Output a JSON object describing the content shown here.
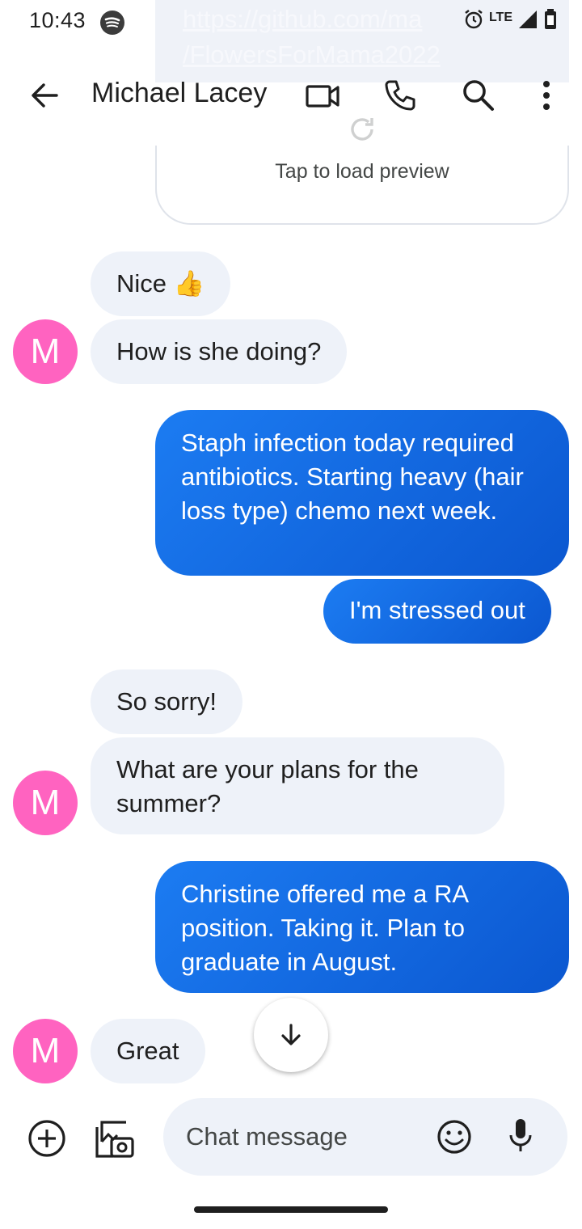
{
  "status_bar": {
    "time": "10:43",
    "network": "LTE",
    "url_overlay": "https://github.com/ma\n/FlowersForMama2022"
  },
  "header": {
    "contact_name": "Michael Lacey"
  },
  "link_preview": {
    "label": "Tap to load preview"
  },
  "messages": [
    {
      "direction": "incoming",
      "text": "Nice 👍"
    },
    {
      "direction": "incoming",
      "text": "How is she doing?",
      "avatar": "M"
    },
    {
      "direction": "outgoing",
      "text": "Staph infection today required antibiotics. Starting heavy (hair loss type) chemo next week."
    },
    {
      "direction": "outgoing",
      "text": "I'm stressed out"
    },
    {
      "direction": "incoming",
      "text": "So sorry!"
    },
    {
      "direction": "incoming",
      "text": "What are your plans for the summer?",
      "avatar": "M"
    },
    {
      "direction": "outgoing",
      "text": "Christine offered me a RA position. Taking it. Plan to graduate in August."
    },
    {
      "direction": "incoming",
      "text": "Great",
      "avatar": "M"
    }
  ],
  "compose": {
    "placeholder": "Chat message"
  },
  "colors": {
    "avatar": "#ff63c0",
    "outgoing_bubble": "#1a73e8",
    "incoming_bubble": "#eef2f9"
  }
}
